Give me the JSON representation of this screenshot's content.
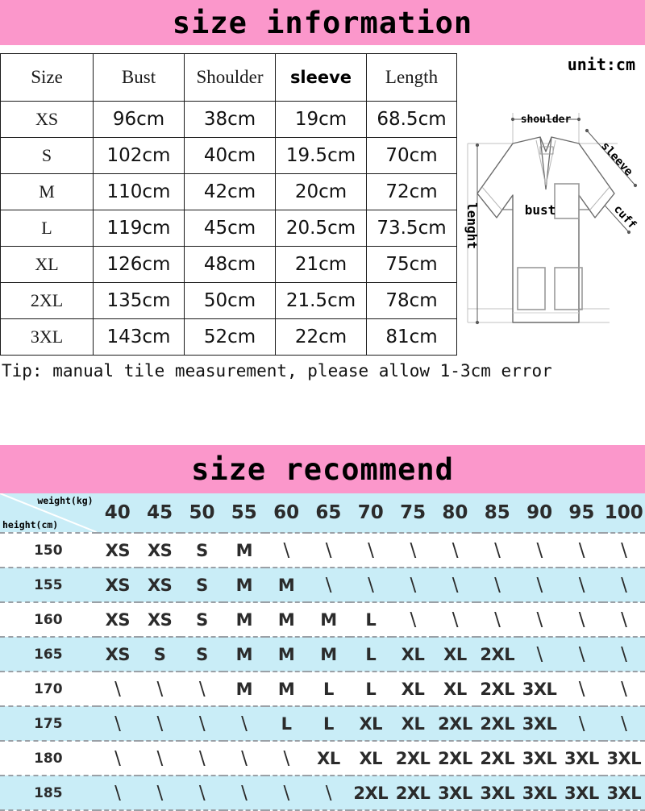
{
  "size_information": {
    "banner_title": "size information",
    "unit_label": "unit:cm",
    "columns": [
      "Size",
      "Bust",
      "Shoulder",
      "sleeve",
      "Length"
    ],
    "rows": [
      {
        "size": "XS",
        "bust": "96cm",
        "shoulder": "38cm",
        "sleeve": "19cm",
        "length": "68.5cm"
      },
      {
        "size": "S",
        "bust": "102cm",
        "shoulder": "40cm",
        "sleeve": "19.5cm",
        "length": "70cm"
      },
      {
        "size": "M",
        "bust": "110cm",
        "shoulder": "42cm",
        "sleeve": "20cm",
        "length": "72cm"
      },
      {
        "size": "L",
        "bust": "119cm",
        "shoulder": "45cm",
        "sleeve": "20.5cm",
        "length": "73.5cm"
      },
      {
        "size": "XL",
        "bust": "126cm",
        "shoulder": "48cm",
        "sleeve": "21cm",
        "length": "75cm"
      },
      {
        "size": "2XL",
        "bust": "135cm",
        "shoulder": "50cm",
        "sleeve": "21.5cm",
        "length": "78cm"
      },
      {
        "size": "3XL",
        "bust": "143cm",
        "shoulder": "52cm",
        "sleeve": "22cm",
        "length": "81cm"
      }
    ],
    "tip": "Tip: manual tile measurement, please allow 1-3cm error"
  },
  "garment_diagram": {
    "labels": {
      "shoulder": "shoulder",
      "sleeve": "sleeve",
      "cuff": "cuff",
      "bust": "bust",
      "length": "lenght"
    }
  },
  "size_recommend": {
    "banner_title": "size recommend",
    "weight_axis_label": "weight(kg)",
    "height_axis_label": "height(cm)",
    "weights": [
      "40",
      "45",
      "50",
      "55",
      "60",
      "65",
      "70",
      "75",
      "80",
      "85",
      "90",
      "95",
      "100"
    ],
    "heights": [
      "150",
      "155",
      "160",
      "165",
      "170",
      "175",
      "180",
      "185"
    ],
    "matrix": [
      [
        "XS",
        "XS",
        "S",
        "M",
        "\\",
        "\\",
        "\\",
        "\\",
        "\\",
        "\\",
        "\\",
        "\\",
        "\\"
      ],
      [
        "XS",
        "XS",
        "S",
        "M",
        "M",
        "\\",
        "\\",
        "\\",
        "\\",
        "\\",
        "\\",
        "\\",
        "\\"
      ],
      [
        "XS",
        "XS",
        "S",
        "M",
        "M",
        "M",
        "L",
        "\\",
        "\\",
        "\\",
        "\\",
        "\\",
        "\\"
      ],
      [
        "XS",
        "S",
        "S",
        "M",
        "M",
        "M",
        "L",
        "XL",
        "XL",
        "2XL",
        "\\",
        "\\",
        "\\"
      ],
      [
        "\\",
        "\\",
        "\\",
        "M",
        "M",
        "L",
        "L",
        "XL",
        "XL",
        "2XL",
        "3XL",
        "\\",
        "\\"
      ],
      [
        "\\",
        "\\",
        "\\",
        "\\",
        "L",
        "L",
        "XL",
        "XL",
        "2XL",
        "2XL",
        "3XL",
        "\\",
        "\\"
      ],
      [
        "\\",
        "\\",
        "\\",
        "\\",
        "\\",
        "XL",
        "XL",
        "2XL",
        "2XL",
        "2XL",
        "3XL",
        "3XL",
        "3XL"
      ],
      [
        "\\",
        "\\",
        "\\",
        "\\",
        "\\",
        "\\",
        "2XL",
        "2XL",
        "3XL",
        "3XL",
        "3XL",
        "3XL",
        "3XL"
      ]
    ]
  },
  "colors": {
    "banner_pink": "#fb97cb",
    "row_blue": "#c9edf7",
    "text_dark": "#1a1a1a"
  }
}
